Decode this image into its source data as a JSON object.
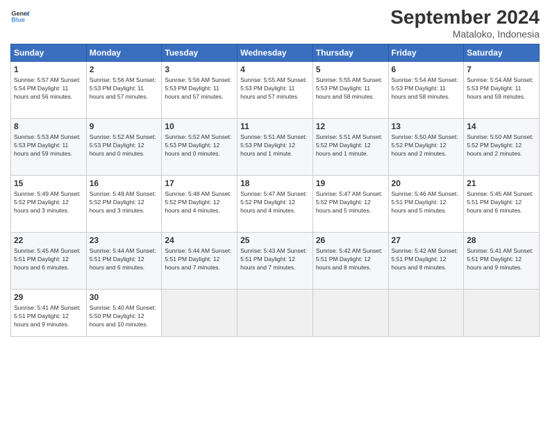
{
  "logo": {
    "line1": "General",
    "line2": "Blue"
  },
  "title": "September 2024",
  "subtitle": "Mataloko, Indonesia",
  "days_of_week": [
    "Sunday",
    "Monday",
    "Tuesday",
    "Wednesday",
    "Thursday",
    "Friday",
    "Saturday"
  ],
  "weeks": [
    [
      {
        "day": "1",
        "info": "Sunrise: 5:57 AM\nSunset: 5:54 PM\nDaylight: 11 hours and 56 minutes."
      },
      {
        "day": "2",
        "info": "Sunrise: 5:56 AM\nSunset: 5:53 PM\nDaylight: 11 hours and 57 minutes."
      },
      {
        "day": "3",
        "info": "Sunrise: 5:56 AM\nSunset: 5:53 PM\nDaylight: 11 hours and 57 minutes."
      },
      {
        "day": "4",
        "info": "Sunrise: 5:55 AM\nSunset: 5:53 PM\nDaylight: 11 hours and 57 minutes."
      },
      {
        "day": "5",
        "info": "Sunrise: 5:55 AM\nSunset: 5:53 PM\nDaylight: 11 hours and 58 minutes."
      },
      {
        "day": "6",
        "info": "Sunrise: 5:54 AM\nSunset: 5:53 PM\nDaylight: 11 hours and 58 minutes."
      },
      {
        "day": "7",
        "info": "Sunrise: 5:54 AM\nSunset: 5:53 PM\nDaylight: 11 hours and 59 minutes."
      }
    ],
    [
      {
        "day": "8",
        "info": "Sunrise: 5:53 AM\nSunset: 5:53 PM\nDaylight: 11 hours and 59 minutes."
      },
      {
        "day": "9",
        "info": "Sunrise: 5:52 AM\nSunset: 5:53 PM\nDaylight: 12 hours and 0 minutes."
      },
      {
        "day": "10",
        "info": "Sunrise: 5:52 AM\nSunset: 5:53 PM\nDaylight: 12 hours and 0 minutes."
      },
      {
        "day": "11",
        "info": "Sunrise: 5:51 AM\nSunset: 5:53 PM\nDaylight: 12 hours and 1 minute."
      },
      {
        "day": "12",
        "info": "Sunrise: 5:51 AM\nSunset: 5:52 PM\nDaylight: 12 hours and 1 minute."
      },
      {
        "day": "13",
        "info": "Sunrise: 5:50 AM\nSunset: 5:52 PM\nDaylight: 12 hours and 2 minutes."
      },
      {
        "day": "14",
        "info": "Sunrise: 5:50 AM\nSunset: 5:52 PM\nDaylight: 12 hours and 2 minutes."
      }
    ],
    [
      {
        "day": "15",
        "info": "Sunrise: 5:49 AM\nSunset: 5:52 PM\nDaylight: 12 hours and 3 minutes."
      },
      {
        "day": "16",
        "info": "Sunrise: 5:48 AM\nSunset: 5:52 PM\nDaylight: 12 hours and 3 minutes."
      },
      {
        "day": "17",
        "info": "Sunrise: 5:48 AM\nSunset: 5:52 PM\nDaylight: 12 hours and 4 minutes."
      },
      {
        "day": "18",
        "info": "Sunrise: 5:47 AM\nSunset: 5:52 PM\nDaylight: 12 hours and 4 minutes."
      },
      {
        "day": "19",
        "info": "Sunrise: 5:47 AM\nSunset: 5:52 PM\nDaylight: 12 hours and 5 minutes."
      },
      {
        "day": "20",
        "info": "Sunrise: 5:46 AM\nSunset: 5:51 PM\nDaylight: 12 hours and 5 minutes."
      },
      {
        "day": "21",
        "info": "Sunrise: 5:45 AM\nSunset: 5:51 PM\nDaylight: 12 hours and 6 minutes."
      }
    ],
    [
      {
        "day": "22",
        "info": "Sunrise: 5:45 AM\nSunset: 5:51 PM\nDaylight: 12 hours and 6 minutes."
      },
      {
        "day": "23",
        "info": "Sunrise: 5:44 AM\nSunset: 5:51 PM\nDaylight: 12 hours and 6 minutes."
      },
      {
        "day": "24",
        "info": "Sunrise: 5:44 AM\nSunset: 5:51 PM\nDaylight: 12 hours and 7 minutes."
      },
      {
        "day": "25",
        "info": "Sunrise: 5:43 AM\nSunset: 5:51 PM\nDaylight: 12 hours and 7 minutes."
      },
      {
        "day": "26",
        "info": "Sunrise: 5:42 AM\nSunset: 5:51 PM\nDaylight: 12 hours and 8 minutes."
      },
      {
        "day": "27",
        "info": "Sunrise: 5:42 AM\nSunset: 5:51 PM\nDaylight: 12 hours and 8 minutes."
      },
      {
        "day": "28",
        "info": "Sunrise: 5:41 AM\nSunset: 5:51 PM\nDaylight: 12 hours and 9 minutes."
      }
    ],
    [
      {
        "day": "29",
        "info": "Sunrise: 5:41 AM\nSunset: 5:51 PM\nDaylight: 12 hours and 9 minutes."
      },
      {
        "day": "30",
        "info": "Sunrise: 5:40 AM\nSunset: 5:50 PM\nDaylight: 12 hours and 10 minutes."
      },
      {
        "day": "",
        "info": ""
      },
      {
        "day": "",
        "info": ""
      },
      {
        "day": "",
        "info": ""
      },
      {
        "day": "",
        "info": ""
      },
      {
        "day": "",
        "info": ""
      }
    ]
  ]
}
